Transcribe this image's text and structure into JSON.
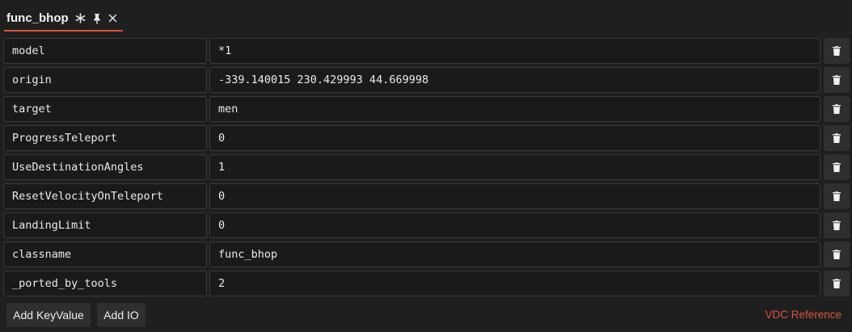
{
  "tab": {
    "title": "func_bhop",
    "icons": [
      "asterisk-icon",
      "pin-icon",
      "close-icon"
    ]
  },
  "properties": [
    {
      "key": "model",
      "value": "*1"
    },
    {
      "key": "origin",
      "value": "-339.140015 230.429993 44.669998"
    },
    {
      "key": "target",
      "value": "men"
    },
    {
      "key": "ProgressTeleport",
      "value": "0"
    },
    {
      "key": "UseDestinationAngles",
      "value": "1"
    },
    {
      "key": "ResetVelocityOnTeleport",
      "value": "0"
    },
    {
      "key": "LandingLimit",
      "value": "0"
    },
    {
      "key": "classname",
      "value": "func_bhop"
    },
    {
      "key": "_ported_by_tools",
      "value": "2"
    }
  ],
  "footer": {
    "add_keyvalue_label": "Add KeyValue",
    "add_io_label": "Add IO",
    "vdc_reference_label": "VDC Reference"
  },
  "colors": {
    "accent": "#d9533a",
    "background": "#1f1f1f",
    "field": "#1a1a1a",
    "button": "#2f2f2f"
  }
}
